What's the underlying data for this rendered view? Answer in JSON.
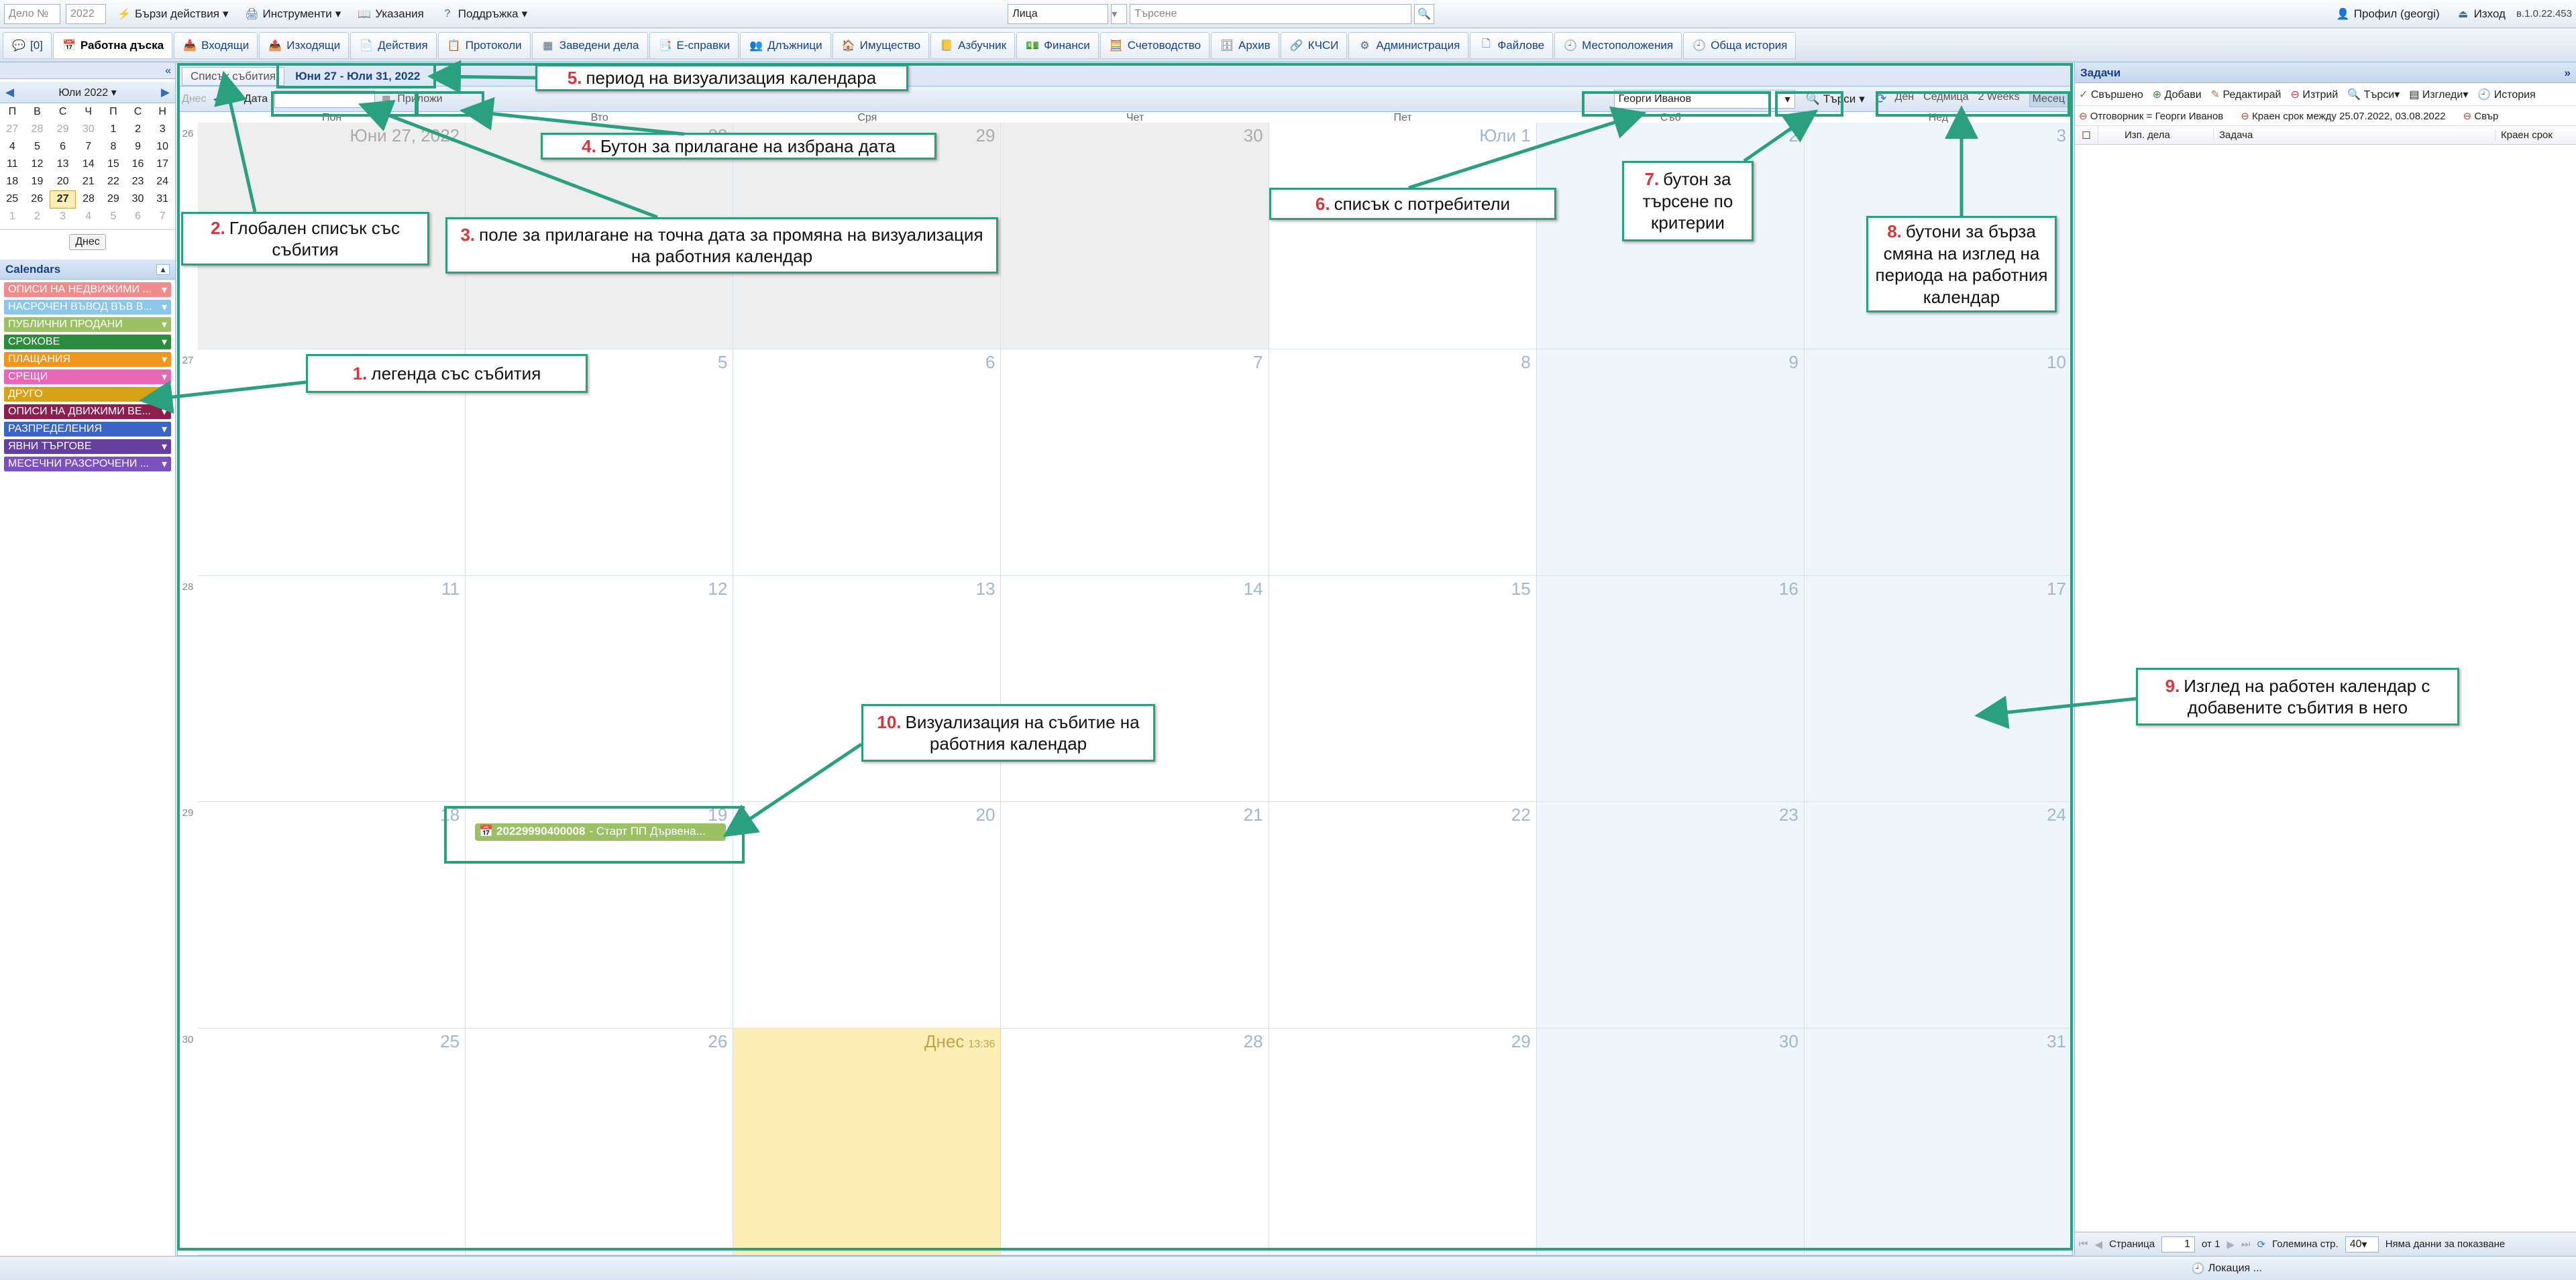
{
  "top": {
    "case_label": "Дело №",
    "year": "2022",
    "quick_actions": "Бързи действия",
    "tools": "Инструменти",
    "instructions": "Указания",
    "support": "Поддръжка",
    "persons": "Лица",
    "search_placeholder": "Търсене",
    "profile": "Профил (georgi)",
    "logout": "Изход",
    "version": "в.1.0.22.453"
  },
  "nav": {
    "chat_count": "[0]",
    "tabs": [
      "Работна дъска",
      "Входящи",
      "Изходящи",
      "Действия",
      "Протоколи",
      "Заведени дела",
      "Е-справки",
      "Длъжници",
      "Имущество",
      "Азбучник",
      "Финанси",
      "Счетоводство",
      "Архив",
      "КЧСИ",
      "Администрация",
      "Файлове",
      "Местоположения",
      "Обща история"
    ]
  },
  "left": {
    "month": "Юли 2022",
    "weekdays": [
      "П",
      "В",
      "С",
      "Ч",
      "П",
      "С",
      "Н"
    ],
    "weeks": [
      [
        "27",
        "28",
        "29",
        "30",
        "1",
        "2",
        "3"
      ],
      [
        "4",
        "5",
        "6",
        "7",
        "8",
        "9",
        "10"
      ],
      [
        "11",
        "12",
        "13",
        "14",
        "15",
        "16",
        "17"
      ],
      [
        "18",
        "19",
        "20",
        "21",
        "22",
        "23",
        "24"
      ],
      [
        "25",
        "26",
        "27",
        "28",
        "29",
        "30",
        "31"
      ],
      [
        "1",
        "2",
        "3",
        "4",
        "5",
        "6",
        "7"
      ]
    ],
    "today_btn": "Днес",
    "calendars_title": "Calendars",
    "legend": [
      {
        "label": "ОПИСИ НА НЕДВИЖИМИ ...",
        "color": "#f08c8c"
      },
      {
        "label": "НАСРОЧЕН ВЪВОД ВЪВ В...",
        "color": "#8cc6ea"
      },
      {
        "label": "ПУБЛИЧНИ ПРОДАНИ",
        "color": "#9cc064"
      },
      {
        "label": "СРОКОВЕ",
        "color": "#2c8c3c"
      },
      {
        "label": "ПЛАЩАНИЯ",
        "color": "#f0961e"
      },
      {
        "label": "СРЕЩИ",
        "color": "#e468b4"
      },
      {
        "label": "ДРУГО",
        "color": "#d7a21a"
      },
      {
        "label": "ОПИСИ НА ДВИЖИМИ ВЕ...",
        "color": "#8c1e50"
      },
      {
        "label": "РАЗПРЕДЕЛЕНИЯ",
        "color": "#3c64c8"
      },
      {
        "label": "ЯВНИ ТЪРГОВЕ",
        "color": "#6440a0"
      },
      {
        "label": "МЕСЕЧНИ РАЗСРОЧЕНИ ...",
        "color": "#7c50c0"
      }
    ]
  },
  "main": {
    "events_list": "Списък събития",
    "period": "Юни 27 - Юли 31, 2022",
    "today": "Днес",
    "date_label": "Дата",
    "apply": "Приложи",
    "user": "Георги Иванов",
    "search": "Търси",
    "views": [
      "Ден",
      "Седмица",
      "2 Weeks",
      "Месец"
    ],
    "day_headers": [
      "Пон",
      "Вто",
      "Сря",
      "Чет",
      "Пет",
      "Съб",
      "Нед"
    ],
    "weeks": [
      {
        "n": "26",
        "days": [
          "Юни 27, 2022",
          "28",
          "29",
          "30",
          "Юли 1",
          "2",
          "3"
        ]
      },
      {
        "n": "27",
        "days": [
          "4",
          "5",
          "6",
          "7",
          "8",
          "9",
          "10"
        ]
      },
      {
        "n": "28",
        "days": [
          "11",
          "12",
          "13",
          "14",
          "15",
          "16",
          "17"
        ]
      },
      {
        "n": "29",
        "days": [
          "18",
          "19",
          "20",
          "21",
          "22",
          "23",
          "24"
        ]
      },
      {
        "n": "30",
        "days": [
          "25",
          "26",
          "Днес",
          "28",
          "29",
          "30",
          "31"
        ]
      }
    ],
    "today_time": "13:36",
    "event": {
      "code": "20229990400008",
      "text": "- Старт ПП Дървена..."
    }
  },
  "right": {
    "title": "Задачи",
    "toolbar": [
      "Свършено",
      "Добави",
      "Редактирай",
      "Изтрий",
      "Търси",
      "Изгледи",
      "История"
    ],
    "filter1": "Отговорник = Георги Иванов",
    "filter2": "Краен срок между 25.07.2022, 03.08.2022",
    "filter3": "Свър",
    "cols": [
      "Изп. дела",
      "Задача",
      "Краен срок"
    ],
    "page_label": "Страница",
    "page": "1",
    "of": "от 1",
    "page_size_label": "Големина стр.",
    "page_size": "40",
    "no_data": "Няма данни за показване"
  },
  "status": {
    "location": "Локация ..."
  },
  "annotations": [
    {
      "n": "1.",
      "t": "легенда със събития"
    },
    {
      "n": "2.",
      "t": "Глобален списък със събития"
    },
    {
      "n": "3.",
      "t": "поле за прилагане на точна дата за промяна на визуализация на работния календар"
    },
    {
      "n": "4.",
      "t": "Бутон за прилагане на избрана дата"
    },
    {
      "n": "5.",
      "t": "период на визуализация календара"
    },
    {
      "n": "6.",
      "t": "списък с потребители"
    },
    {
      "n": "7.",
      "t": "бутон за търсене по критерии"
    },
    {
      "n": "8.",
      "t": "бутони за бърза смяна на изглед на периода на работния календар"
    },
    {
      "n": "9.",
      "t": "Изглед на работен календар с добавените събития в него"
    },
    {
      "n": "10.",
      "t": "Визуализация на събитие на работния календар"
    }
  ],
  "colors": {
    "accent": "#2aa07f",
    "number": "#d7373a",
    "header": "#15428b",
    "today": "#fdeeb5",
    "event": "#9cc064"
  }
}
